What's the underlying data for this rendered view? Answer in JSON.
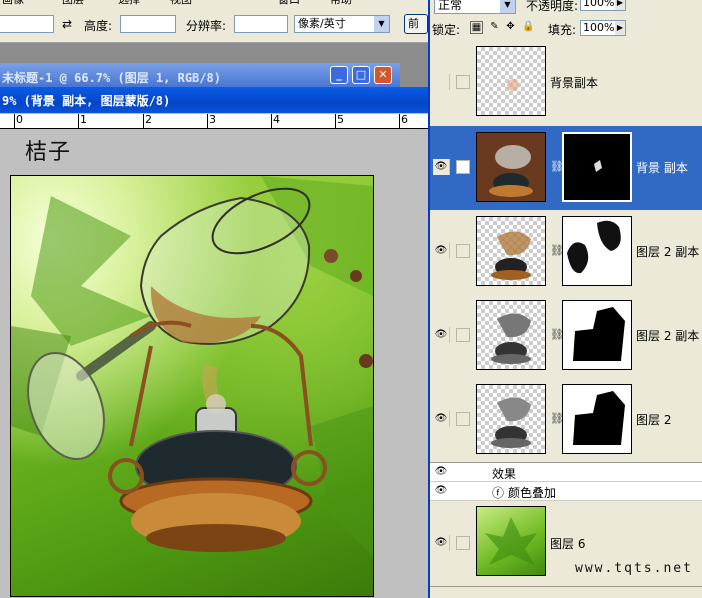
{
  "options_bar": {
    "menu_fragments": [
      "画像",
      "图层",
      "选择",
      "视图",
      "窗口",
      "帮助"
    ],
    "height_label": "高度:",
    "resolution_label": "分辨率:",
    "unit_select": "像素/英寸",
    "front_button": "前"
  },
  "windows": {
    "back_title": "未标题-1 @ 66.7% (图层 1, RGB/8)",
    "front_title": "9% (背景 副本, 图层蒙版/8)",
    "ruler_numbers": [
      "0",
      "1",
      "2",
      "3",
      "4",
      "5",
      "6"
    ],
    "doc_text": "桔子"
  },
  "layers_panel": {
    "blend_mode": "正常",
    "opacity_label": "不透明度:",
    "opacity_value": "100%",
    "lock_label": "锁定:",
    "fill_label": "填充:",
    "fill_value": "100%",
    "layers": [
      {
        "name": "背景副本",
        "visible": false,
        "active": false,
        "has_mask": false
      },
      {
        "name": "背景 副本",
        "visible": true,
        "active": true,
        "has_mask": true
      },
      {
        "name": "图层 2 副本",
        "visible": true,
        "active": false,
        "has_mask": true
      },
      {
        "name": "图层 2  副本",
        "visible": true,
        "active": false,
        "has_mask": true
      },
      {
        "name": "图层 2",
        "visible": true,
        "active": false,
        "has_mask": true
      },
      {
        "name": "图层 6",
        "visible": true,
        "active": false,
        "has_mask": false
      }
    ],
    "effects_label": "效果",
    "effect_item": "颜色叠加"
  },
  "watermark": "www.tqts.net",
  "colors": {
    "active_layer": "#316ac5",
    "title_bar": "#0a52d8",
    "panel_bg": "#ece9d8"
  }
}
